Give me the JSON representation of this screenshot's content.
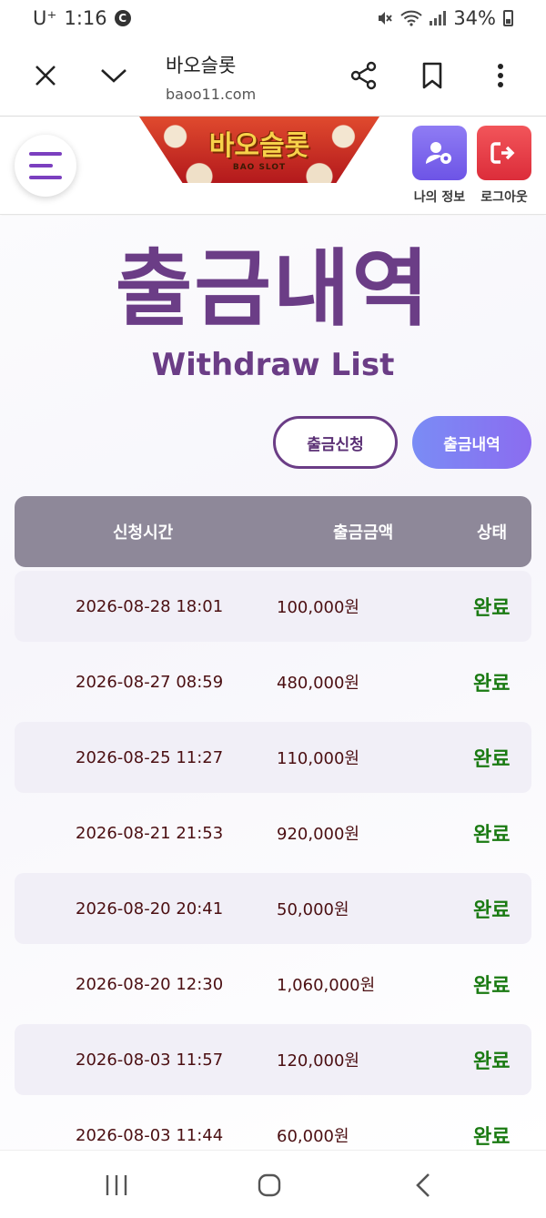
{
  "status_bar": {
    "carrier": "U⁺",
    "time": "1:16",
    "carrier_badge": "C",
    "battery": "34%"
  },
  "browser": {
    "page_title": "바오슬롯",
    "host": "baoo11.com",
    "icons": [
      "close-icon",
      "chevron-down-icon",
      "share-icon",
      "bookmark-icon",
      "more-vert-icon"
    ]
  },
  "header": {
    "logo_text": "바오슬롯",
    "logo_sub": "BAO SLOT",
    "my_info_label": "나의 정보",
    "logout_label": "로그아웃"
  },
  "page": {
    "title": "출금내역",
    "subtitle": "Withdraw List",
    "apply_button": "출금신청",
    "history_button": "출금내역"
  },
  "table": {
    "headers": {
      "time": "신청시간",
      "amount": "출금금액",
      "status": "상태"
    },
    "rows": [
      {
        "time": "2026-08-28 18:01",
        "amount": "100,000원",
        "status": "완료"
      },
      {
        "time": "2026-08-27 08:59",
        "amount": "480,000원",
        "status": "완료"
      },
      {
        "time": "2026-08-25 11:27",
        "amount": "110,000원",
        "status": "완료"
      },
      {
        "time": "2026-08-21 21:53",
        "amount": "920,000원",
        "status": "완료"
      },
      {
        "time": "2026-08-20 20:41",
        "amount": "50,000원",
        "status": "완료"
      },
      {
        "time": "2026-08-20 12:30",
        "amount": "1,060,000원",
        "status": "완료"
      },
      {
        "time": "2026-08-03 11:57",
        "amount": "120,000원",
        "status": "완료"
      },
      {
        "time": "2026-08-03 11:44",
        "amount": "60,000원",
        "status": "완료"
      }
    ]
  },
  "colors": {
    "brand_purple": "#6b3d86",
    "status_green": "#1a7a12",
    "header_gray": "#8e8899",
    "row_shade": "#f1eff7"
  }
}
